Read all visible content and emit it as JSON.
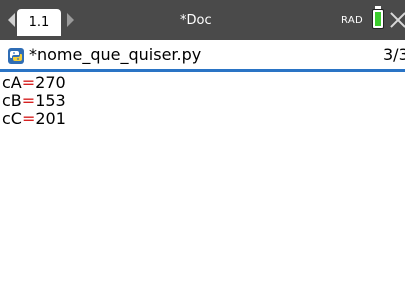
{
  "topbar": {
    "tab_label": "1.1",
    "doc_title": "*Doc",
    "mode": "RAD"
  },
  "file_header": {
    "file_name": "*nome_que_quiser.py",
    "page_count": "3/3"
  },
  "output": {
    "lines": [
      {
        "var": "cA",
        "op": "=",
        "value": "270"
      },
      {
        "var": "cB",
        "op": "=",
        "value": "153"
      },
      {
        "var": "cC",
        "op": "=",
        "value": "201"
      }
    ]
  },
  "colors": {
    "topbar_bg": "#4a4a4a",
    "header_underline": "#2a74c5",
    "equals_sign": "#d62020",
    "battery_fill": "#3bcc2c"
  },
  "icons": [
    "tab-left-arrow-icon",
    "tab-right-arrow-icon",
    "battery-icon",
    "close-icon",
    "python-icon"
  ]
}
